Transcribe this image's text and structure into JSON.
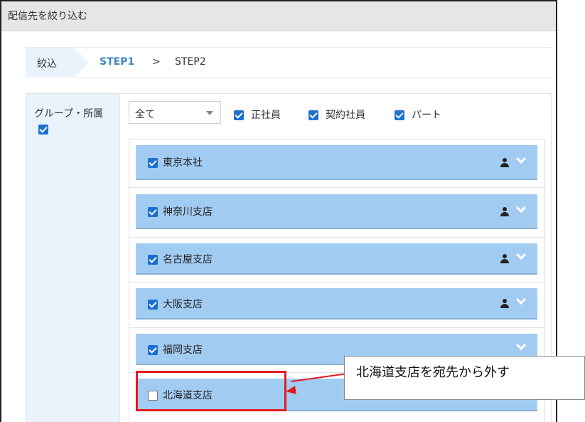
{
  "window": {
    "title": "配信先を絞り込む"
  },
  "steps": {
    "current_label": "絞込",
    "step1": "STEP1",
    "separator": ">",
    "step2": "STEP2"
  },
  "filter": {
    "group_label": "グループ・所属",
    "group_checked": true,
    "scope_select": {
      "value": "全て"
    },
    "employment_types": [
      {
        "label": "正社員",
        "checked": true
      },
      {
        "label": "契約社員",
        "checked": true
      },
      {
        "label": "パート",
        "checked": true
      }
    ]
  },
  "branches": [
    {
      "name": "東京本社",
      "checked": true,
      "has_person_icon": true
    },
    {
      "name": "神奈川支店",
      "checked": true,
      "has_person_icon": true
    },
    {
      "name": "名古屋支店",
      "checked": true,
      "has_person_icon": true
    },
    {
      "name": "大阪支店",
      "checked": true,
      "has_person_icon": true
    },
    {
      "name": "福岡支店",
      "checked": true,
      "has_person_icon": false
    },
    {
      "name": "北海道支店",
      "checked": false,
      "has_person_icon": false
    }
  ],
  "annotation": {
    "callout_text": "北海道支店を宛先から外す",
    "color": "#e11b22"
  },
  "colors": {
    "accent": "#3d87c0",
    "branch_bg": "#a2cbf2",
    "checkbox": "#1e6fd0"
  }
}
